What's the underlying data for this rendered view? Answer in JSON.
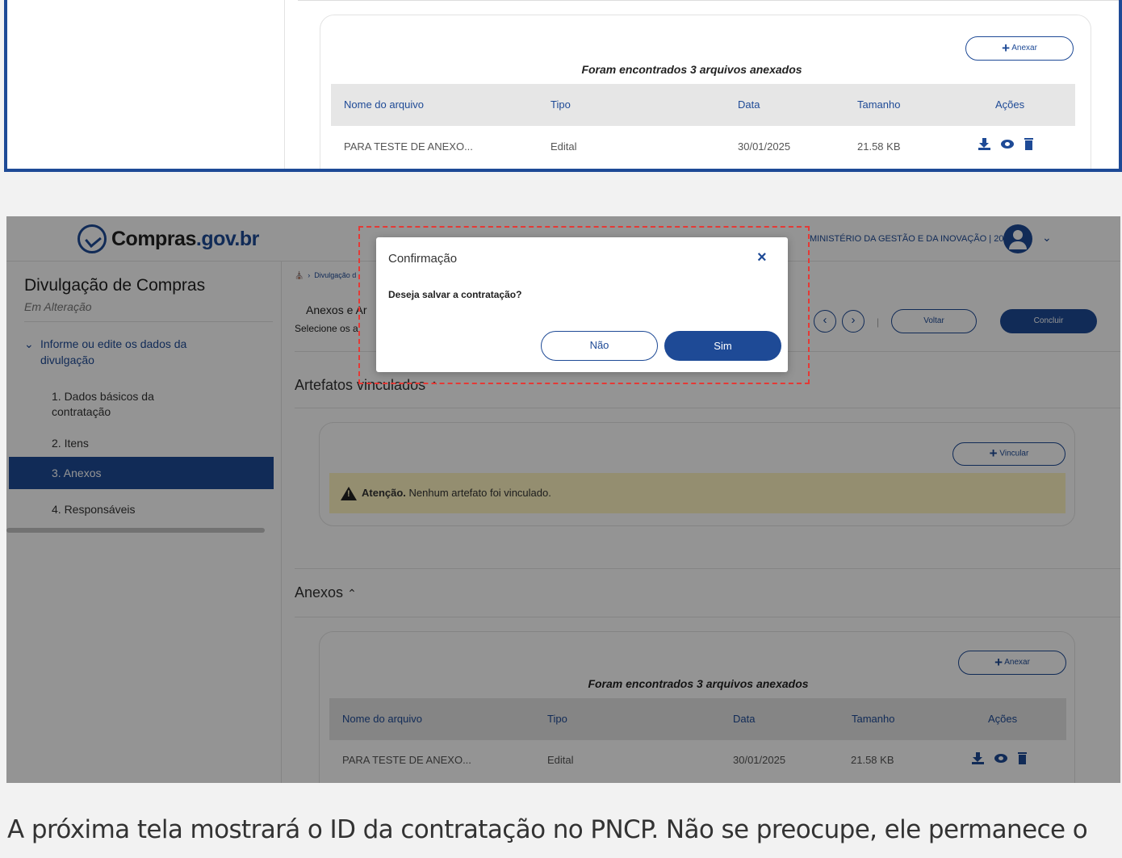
{
  "top_snippet": {
    "attachments_count_text": "Foram encontrados 3 arquivos anexados",
    "attach_button": "Anexar",
    "columns": [
      "Nome do arquivo",
      "Tipo",
      "Data",
      "Tamanho",
      "Ações"
    ],
    "row": {
      "name": "PARA TESTE DE ANEXO...",
      "type": "Edital",
      "date": "30/01/2025",
      "size": "21.58 KB"
    }
  },
  "header": {
    "logo_text_main": "Compras",
    "logo_text_accent": ".gov.br",
    "org_text": "MINISTÉRIO DA GESTÃO E DA INOVAÇÃO | 200999",
    "user_icon": "user-circle-icon"
  },
  "sidebar": {
    "title": "Divulgação de Compras",
    "subtitle": "Em Alteração",
    "section": "Informe ou edite os dados da divulgação",
    "steps": [
      {
        "label": "1. Dados básicos da contratação",
        "active": false
      },
      {
        "label": "2. Itens",
        "active": false
      },
      {
        "label": "3. Anexos",
        "active": true
      },
      {
        "label": "4. Responsáveis",
        "active": false
      }
    ]
  },
  "main": {
    "breadcrumb": "Divulgação d",
    "page_title": "Anexos e Ar",
    "page_subtitle": "Selecione os a",
    "back_button": "Voltar",
    "finish_button": "Concluir",
    "artefatos": {
      "title": "Artefatos vinculados",
      "link_button": "Vincular",
      "alert_bold": "Atenção.",
      "alert_text": " Nenhum artefato foi vinculado."
    },
    "anexos": {
      "title": "Anexos",
      "attach_button": "Anexar",
      "count_text": "Foram encontrados 3 arquivos anexados",
      "columns": [
        "Nome do arquivo",
        "Tipo",
        "Data",
        "Tamanho",
        "Ações"
      ],
      "rows": [
        {
          "name": "PARA TESTE DE ANEXO...",
          "type": "Edital",
          "date": "30/01/2025",
          "size": "21.58 KB"
        }
      ]
    }
  },
  "modal": {
    "title": "Confirmação",
    "message": "Deseja salvar a contratação?",
    "no_button": "Não",
    "yes_button": "Sim"
  },
  "caption": "A próxima tela mostrará o ID da contratação no PNCP. Não se preocupe, ele permanece o",
  "colors": {
    "primary": "#1e4a96",
    "alert_bg": "#fff5c2",
    "highlight": "#e53935"
  }
}
